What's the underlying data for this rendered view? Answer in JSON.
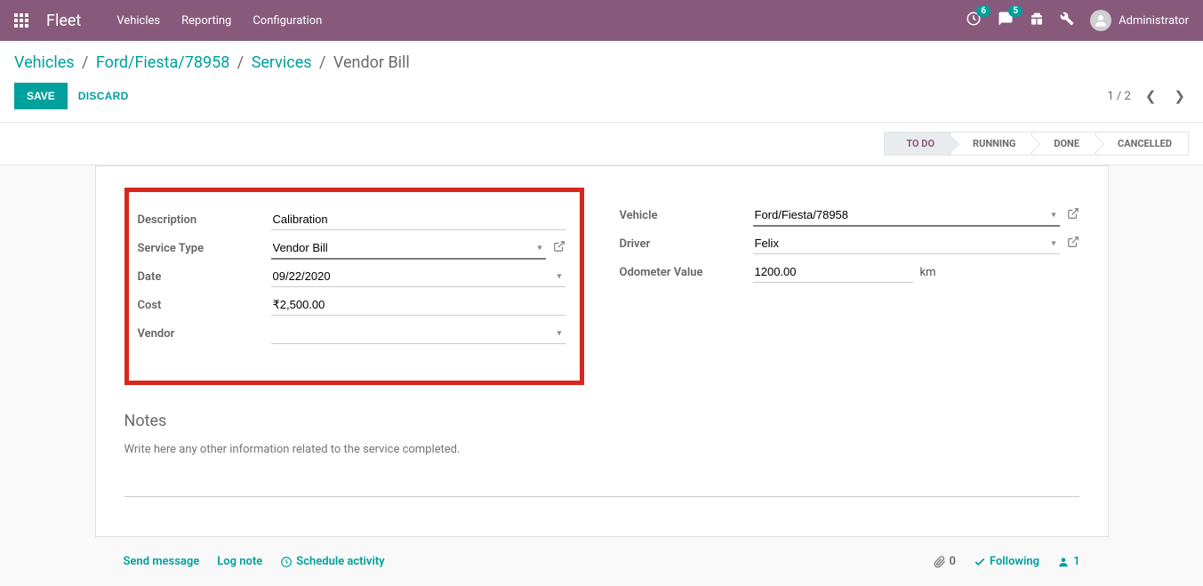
{
  "header": {
    "app_name": "Fleet",
    "nav": [
      "Vehicles",
      "Reporting",
      "Configuration"
    ],
    "badge1": "6",
    "badge2": "5",
    "user": "Administrator"
  },
  "breadcrumb": {
    "items": [
      "Vehicles",
      "Ford/Fiesta/78958",
      "Services"
    ],
    "current": "Vendor Bill"
  },
  "actions": {
    "save": "SAVE",
    "discard": "DISCARD"
  },
  "pager": {
    "text": "1 / 2"
  },
  "status": {
    "steps": [
      "TO DO",
      "RUNNING",
      "DONE",
      "CANCELLED"
    ]
  },
  "form": {
    "left": {
      "description": {
        "label": "Description",
        "value": "Calibration"
      },
      "service_type": {
        "label": "Service Type",
        "value": "Vendor Bill"
      },
      "date": {
        "label": "Date",
        "value": "09/22/2020"
      },
      "cost": {
        "label": "Cost",
        "value": "₹2,500.00"
      },
      "vendor": {
        "label": "Vendor",
        "value": ""
      }
    },
    "right": {
      "vehicle": {
        "label": "Vehicle",
        "value": "Ford/Fiesta/78958"
      },
      "driver": {
        "label": "Driver",
        "value": "Felix"
      },
      "odometer": {
        "label": "Odometer Value",
        "value": "1200.00",
        "unit": "km"
      }
    },
    "notes": {
      "title": "Notes",
      "placeholder": "Write here any other information related to the service completed."
    }
  },
  "chatter": {
    "send_message": "Send message",
    "log_note": "Log note",
    "schedule_activity": "Schedule activity",
    "attachments": "0",
    "following": "Following",
    "followers": "1"
  }
}
